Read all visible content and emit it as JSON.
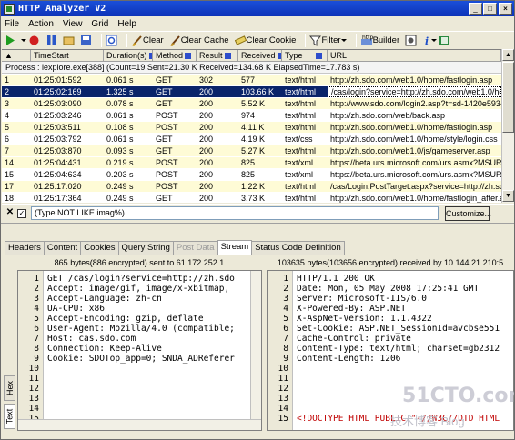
{
  "window": {
    "title": "HTTP Analyzer V2"
  },
  "menu": [
    "File",
    "Action",
    "View",
    "Grid",
    "Help"
  ],
  "toolbar": {
    "clear": "Clear",
    "clear_cache": "Clear Cache",
    "clear_cookie": "Clear Cookie",
    "filter": "Filter",
    "builder": "Builder"
  },
  "grid": {
    "columns": [
      "TimeStart",
      "Duration(s)",
      "Method",
      "Result",
      "Received",
      "Type",
      "URL"
    ],
    "process_row": "Process : iexplore.exe[388] (Count=19    Sent=21.30 K    Received=134.68 K    ElapsedTime=17.783 s)",
    "rows": [
      {
        "num": "1",
        "time": "01:25:01:592",
        "dur": "0.061 s",
        "method": "GET",
        "result": "302",
        "recv": "577",
        "type": "text/html",
        "url": "http://zh.sdo.com/web1.0/home/fastlogin.asp"
      },
      {
        "num": "2",
        "time": "01:25:02:169",
        "dur": "1.325 s",
        "method": "GET",
        "result": "200",
        "recv": "103.66 K",
        "type": "text/html",
        "url": "/cas/login?service=http://zh.sdo.com/web1.0/hom"
      },
      {
        "num": "3",
        "time": "01:25:03:090",
        "dur": "0.078 s",
        "method": "GET",
        "result": "200",
        "recv": "5.52 K",
        "type": "text/html",
        "url": "http://www.sdo.com/login2.asp?t=sd-1420e593-d2"
      },
      {
        "num": "4",
        "time": "01:25:03:246",
        "dur": "0.061 s",
        "method": "POST",
        "result": "200",
        "recv": "974",
        "type": "text/html",
        "url": "http://zh.sdo.com/web/back.asp"
      },
      {
        "num": "5",
        "time": "01:25:03:511",
        "dur": "0.108 s",
        "method": "POST",
        "result": "200",
        "recv": "4.11 K",
        "type": "text/html",
        "url": "http://zh.sdo.com/web1.0/home/fastlogin.asp"
      },
      {
        "num": "6",
        "time": "01:25:03:792",
        "dur": "0.061 s",
        "method": "GET",
        "result": "200",
        "recv": "4.19 K",
        "type": "text/css",
        "url": "http://zh.sdo.com/web1.0/home/style/login.css"
      },
      {
        "num": "7",
        "time": "01:25:03:870",
        "dur": "0.093 s",
        "method": "GET",
        "result": "200",
        "recv": "5.27 K",
        "type": "text/html",
        "url": "http://zh.sdo.com/web1.0/js/gameserver.asp"
      },
      {
        "num": "14",
        "time": "01:25:04:431",
        "dur": "0.219 s",
        "method": "POST",
        "result": "200",
        "recv": "825",
        "type": "text/xml",
        "url": "https://beta.urs.microsoft.com/urs.asmx?MSURS-C"
      },
      {
        "num": "15",
        "time": "01:25:04:634",
        "dur": "0.203 s",
        "method": "POST",
        "result": "200",
        "recv": "825",
        "type": "text/xml",
        "url": "https://beta.urs.microsoft.com/urs.asmx?MSURS-C"
      },
      {
        "num": "17",
        "time": "01:25:17:020",
        "dur": "0.249 s",
        "method": "POST",
        "result": "200",
        "recv": "1.22 K",
        "type": "text/html",
        "url": "/cas/Login.PostTarget.aspx?service=http://zh.sdo"
      },
      {
        "num": "18",
        "time": "01:25:17:364",
        "dur": "0.249 s",
        "method": "GET",
        "result": "200",
        "recv": "3.73 K",
        "type": "text/html",
        "url": "http://zh.sdo.com/web1.0/home/fastlogin_after.asp"
      }
    ]
  },
  "filter": {
    "expression": "(Type NOT LIKE imag%)",
    "customize": "Customize..."
  },
  "tabs": [
    "Headers",
    "Content",
    "Cookies",
    "Query String",
    "Post Data",
    "Stream",
    "Status Code Definition"
  ],
  "left_pane": {
    "header": "865 bytes(886 encrypted) sent to 61.172.252.1",
    "line_numbers": [
      "1",
      "2",
      "3",
      "4",
      "5",
      "6",
      "7",
      "8",
      "9",
      "10",
      "11",
      "12",
      "13",
      "14",
      "15"
    ],
    "lines": [
      "GET /cas/login?service=http://zh.sdo",
      "Accept: image/gif, image/x-xbitmap,",
      "Accept-Language: zh-cn",
      "UA-CPU: x86",
      "Accept-Encoding: gzip, deflate",
      "User-Agent: Mozilla/4.0 (compatible;",
      "Host: cas.sdo.com",
      "Connection: Keep-Alive",
      "Cookie: SDOTop_app=0; SNDA_ADReferer"
    ]
  },
  "right_pane": {
    "header": "103635 bytes(103656 encrypted) received by 10.144.21.210:5",
    "line_numbers": [
      "1",
      "2",
      "3",
      "4",
      "5",
      "6",
      "7",
      "8",
      "9",
      "10",
      "11",
      "12",
      "13",
      "14",
      "15"
    ],
    "lines": [
      "HTTP/1.1 200 OK",
      "Date: Mon, 05 May 2008 17:25:41 GMT",
      "Server: Microsoft-IIS/6.0",
      "X-Powered-By: ASP.NET",
      "X-AspNet-Version: 1.1.4322",
      "Set-Cookie: ASP.NET_SessionId=avcbse551",
      "Cache-Control: private",
      "Content-Type: text/html; charset=gb2312",
      "Content-Length: 1206"
    ],
    "doctype_line": "<!DOCTYPE HTML PUBLIC \"-//W3C//DTD HTML"
  },
  "side_tabs": [
    "Hex",
    "Text"
  ],
  "watermark": {
    "brand": "51CTO.com",
    "subtitle": "技术博客  Blog"
  }
}
